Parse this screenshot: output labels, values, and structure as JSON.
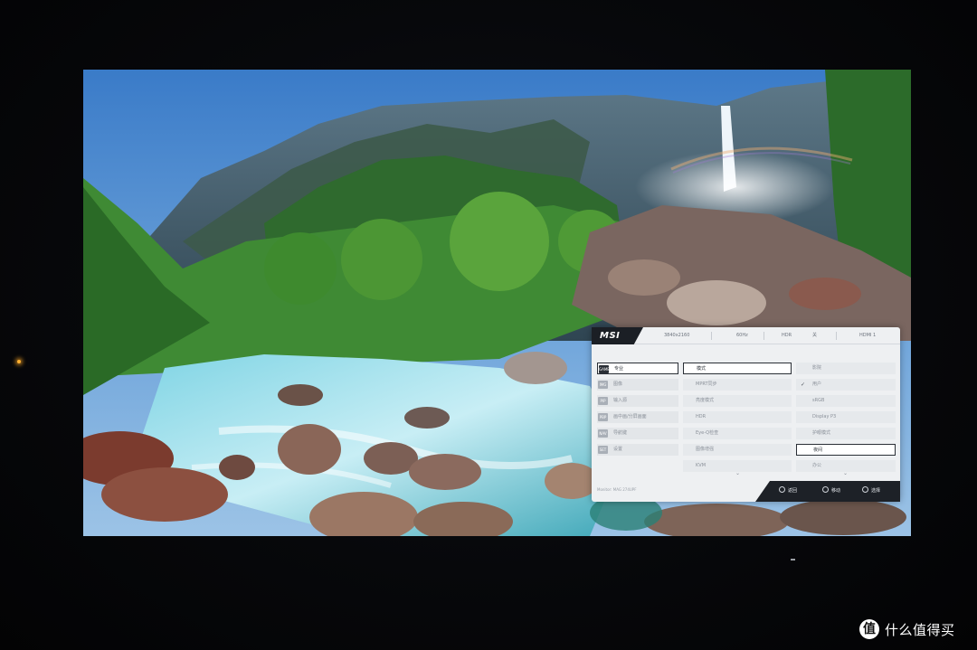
{
  "osd": {
    "brand": "MSI",
    "status": [
      "3840x2160",
      "60Hz",
      "HDR",
      "关",
      "HDMI 1"
    ],
    "menu": [
      {
        "icon": "GAME",
        "label": "专业"
      },
      {
        "icon": "IMG",
        "label": "图像"
      },
      {
        "icon": "PIP",
        "label": "输入源"
      },
      {
        "icon": "PBP",
        "label": "画中画/分屏画面"
      },
      {
        "icon": "NAV",
        "label": "导航键"
      },
      {
        "icon": "SET",
        "label": "设置"
      }
    ],
    "col2": [
      "模式",
      "MPRT同步",
      "亮度模式",
      "HDR",
      "Eye-Q检查",
      "图像增强",
      "KVM"
    ],
    "col3": [
      "影院",
      "用户",
      "sRGB",
      "Display P3",
      "护眼模式",
      "夜间",
      "办公"
    ],
    "selected_col3_index": 5,
    "checked_col3_index": 1,
    "model": "Monitor: MAG 274UPF",
    "footer": [
      "返回",
      "移动",
      "选择"
    ]
  },
  "watermark": {
    "logo": "值",
    "text": "什么值得买"
  },
  "colors": {
    "osd_bg": "#eef0f2",
    "osd_dark": "#1d2127",
    "screen_sky": "#3a7bc8"
  }
}
